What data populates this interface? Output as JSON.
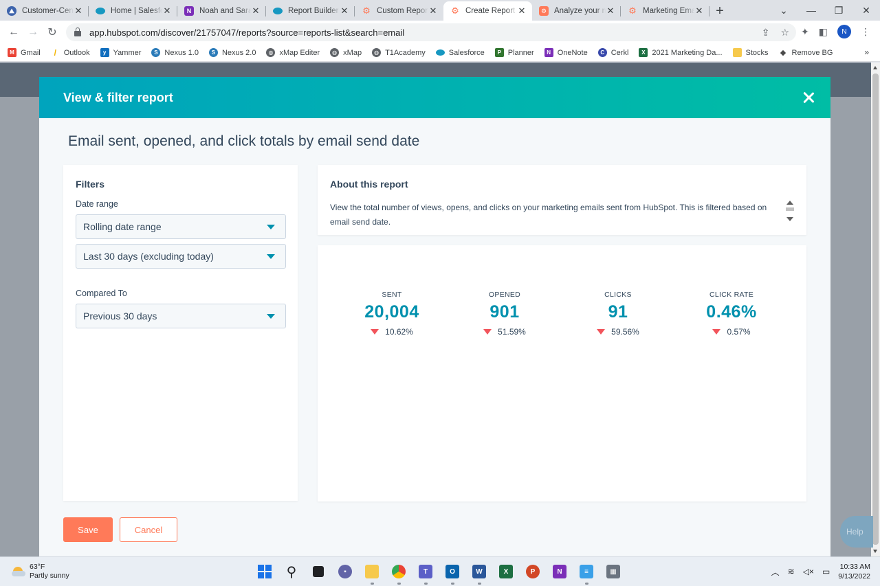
{
  "browser": {
    "tabs": [
      {
        "title": "Customer-Cent",
        "icon": "salesforce-trailhead-icon",
        "color": "#3e64ac"
      },
      {
        "title": "Home | Salesfo",
        "icon": "salesforce-cloud-icon",
        "color": "#1798c1"
      },
      {
        "title": "Noah and Sara",
        "icon": "onenote-icon",
        "color": "#7b2fb8"
      },
      {
        "title": "Report Builder",
        "icon": "salesforce-cloud-icon",
        "color": "#1798c1"
      },
      {
        "title": "Custom Report",
        "icon": "hubspot-sprocket-icon",
        "color": "#ff7a59"
      },
      {
        "title": "Create Report",
        "icon": "hubspot-sprocket-icon",
        "color": "#ff7a59"
      },
      {
        "title": "Analyze your m",
        "icon": "hubspot-sprocket-icon",
        "color": "#ff7a59"
      },
      {
        "title": "Marketing Ema",
        "icon": "hubspot-sprocket-icon",
        "color": "#ff7a59"
      }
    ],
    "url": "app.hubspot.com/discover/21757047/reports?source=reports-list&search=email",
    "profile_initial": "N",
    "bookmarks": [
      {
        "label": "Gmail",
        "icon": "gmail-icon",
        "color": "#ea4335"
      },
      {
        "label": "Outlook",
        "icon": "outlook-icon",
        "color": "#f4b400"
      },
      {
        "label": "Yammer",
        "icon": "yammer-icon",
        "color": "#106ebe"
      },
      {
        "label": "Nexus 1.0",
        "icon": "nexus-icon",
        "color": "#2b7bb9"
      },
      {
        "label": "Nexus 2.0",
        "icon": "nexus-icon",
        "color": "#2b7bb9"
      },
      {
        "label": "xMap Editer",
        "icon": "globe-icon",
        "color": "#5f6368"
      },
      {
        "label": "xMap",
        "icon": "globe-icon",
        "color": "#5f6368"
      },
      {
        "label": "T1Academy",
        "icon": "globe-icon",
        "color": "#5f6368"
      },
      {
        "label": "Salesforce",
        "icon": "salesforce-cloud-icon",
        "color": "#1798c1"
      },
      {
        "label": "Planner",
        "icon": "planner-icon",
        "color": "#31752f"
      },
      {
        "label": "OneNote",
        "icon": "onenote-icon",
        "color": "#7b2fb8"
      },
      {
        "label": "Cerkl",
        "icon": "cerkl-icon",
        "color": "#3949ab"
      },
      {
        "label": "2021 Marketing Da...",
        "icon": "excel-icon",
        "color": "#1d6f42"
      },
      {
        "label": "Stocks",
        "icon": "folder-icon",
        "color": "#f6c94c"
      },
      {
        "label": "Remove BG",
        "icon": "layers-icon",
        "color": "#4a4a4a"
      }
    ]
  },
  "modal": {
    "title": "View & filter report",
    "report_title": "Email sent, opened, and click totals by email send date",
    "filters": {
      "heading": "Filters",
      "date_range_label": "Date range",
      "date_range_type": "Rolling date range",
      "date_range_value": "Last 30 days (excluding today)",
      "compared_to_label": "Compared To",
      "compared_to_value": "Previous 30 days"
    },
    "about": {
      "heading": "About this report",
      "text": "View the total number of views, opens, and clicks on your marketing emails sent from HubSpot. This is filtered based on email send date."
    },
    "metrics": [
      {
        "label": "SENT",
        "value": "20,004",
        "change": "10.62%",
        "direction": "down"
      },
      {
        "label": "OPENED",
        "value": "901",
        "change": "51.59%",
        "direction": "down"
      },
      {
        "label": "CLICKS",
        "value": "91",
        "change": "59.56%",
        "direction": "down"
      },
      {
        "label": "CLICK RATE",
        "value": "0.46%",
        "change": "0.57%",
        "direction": "down"
      }
    ],
    "save_label": "Save",
    "cancel_label": "Cancel"
  },
  "help_label": "Help",
  "taskbar": {
    "temperature": "63°F",
    "condition": "Partly sunny",
    "time": "10:33 AM",
    "date": "9/13/2022"
  },
  "colors": {
    "header_start": "#00a4bd",
    "header_end": "#00bda5",
    "metric_value": "#0091ae",
    "decrease": "#f2545b",
    "primary_button": "#ff7a59"
  }
}
